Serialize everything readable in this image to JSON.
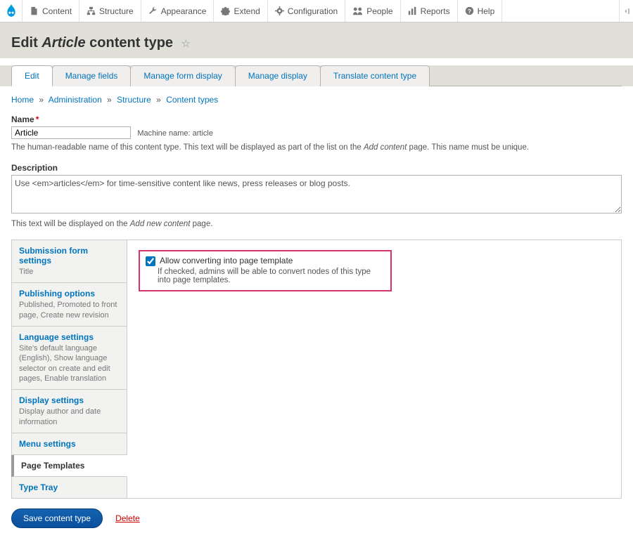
{
  "toolbar": {
    "items": [
      {
        "label": "Content"
      },
      {
        "label": "Structure"
      },
      {
        "label": "Appearance"
      },
      {
        "label": "Extend"
      },
      {
        "label": "Configuration"
      },
      {
        "label": "People"
      },
      {
        "label": "Reports"
      },
      {
        "label": "Help"
      }
    ]
  },
  "page": {
    "title_prefix": "Edit ",
    "title_em": "Article",
    "title_suffix": " content type"
  },
  "tabs": [
    {
      "label": "Edit",
      "active": true
    },
    {
      "label": "Manage fields"
    },
    {
      "label": "Manage form display"
    },
    {
      "label": "Manage display"
    },
    {
      "label": "Translate content type"
    }
  ],
  "breadcrumb": {
    "home": "Home",
    "admin": "Administration",
    "structure": "Structure",
    "types": "Content types",
    "sep": "»"
  },
  "fields": {
    "name": {
      "label": "Name",
      "value": "Article",
      "machine_prefix": "Machine name: ",
      "machine_value": "article",
      "help_a": "The human-readable name of this content type. This text will be displayed as part of the list on the ",
      "help_em": "Add content",
      "help_b": " page. This name must be unique."
    },
    "description": {
      "label": "Description",
      "value": "Use <em>articles</em> for time-sensitive content like news, press releases or blog posts.",
      "help_a": "This text will be displayed on the ",
      "help_em": "Add new content",
      "help_b": " page."
    }
  },
  "vtabs": [
    {
      "title": "Submission form settings",
      "summary": "Title"
    },
    {
      "title": "Publishing options",
      "summary": "Published, Promoted to front page, Create new revision"
    },
    {
      "title": "Language settings",
      "summary": "Site's default language (English), Show language selector on create and edit pages, Enable translation"
    },
    {
      "title": "Display settings",
      "summary": "Display author and date information"
    },
    {
      "title": "Menu settings",
      "summary": ""
    },
    {
      "title": "Page Templates",
      "summary": "",
      "active": true
    },
    {
      "title": "Type Tray",
      "summary": ""
    }
  ],
  "pane": {
    "checkbox_label": "Allow converting into page template",
    "checkbox_desc": "If checked, admins will be able to convert nodes of this type into page templates."
  },
  "actions": {
    "save": "Save content type",
    "delete": "Delete"
  }
}
